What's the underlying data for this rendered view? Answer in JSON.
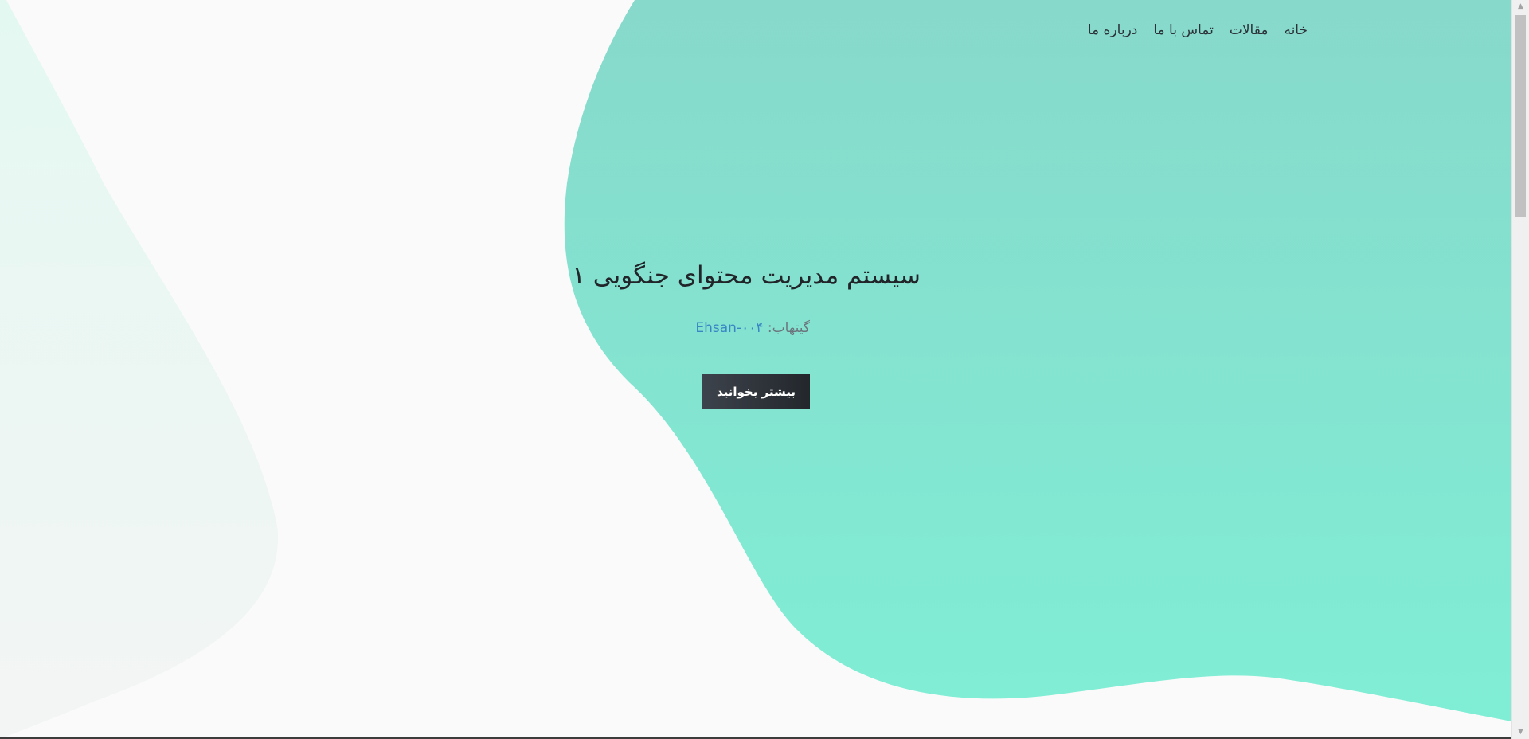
{
  "nav": {
    "items": [
      {
        "label": "خانه"
      },
      {
        "label": "مقالات"
      },
      {
        "label": "تماس با ما"
      },
      {
        "label": "درباره ما"
      }
    ]
  },
  "hero": {
    "title": "سیستم مدیریت محتوای جنگویی ۱",
    "github_label": "گیتهاب:",
    "github_user": "Ehsan-۰۰۴",
    "button_label": "بیشتر بخوانید"
  },
  "colors": {
    "background": "#fafafa",
    "blob_top": "#87d9cb",
    "blob_bottom": "#80eed5",
    "left_blob": "#e4f8f2",
    "button": "#2f343a",
    "link": "#3a86c4"
  }
}
